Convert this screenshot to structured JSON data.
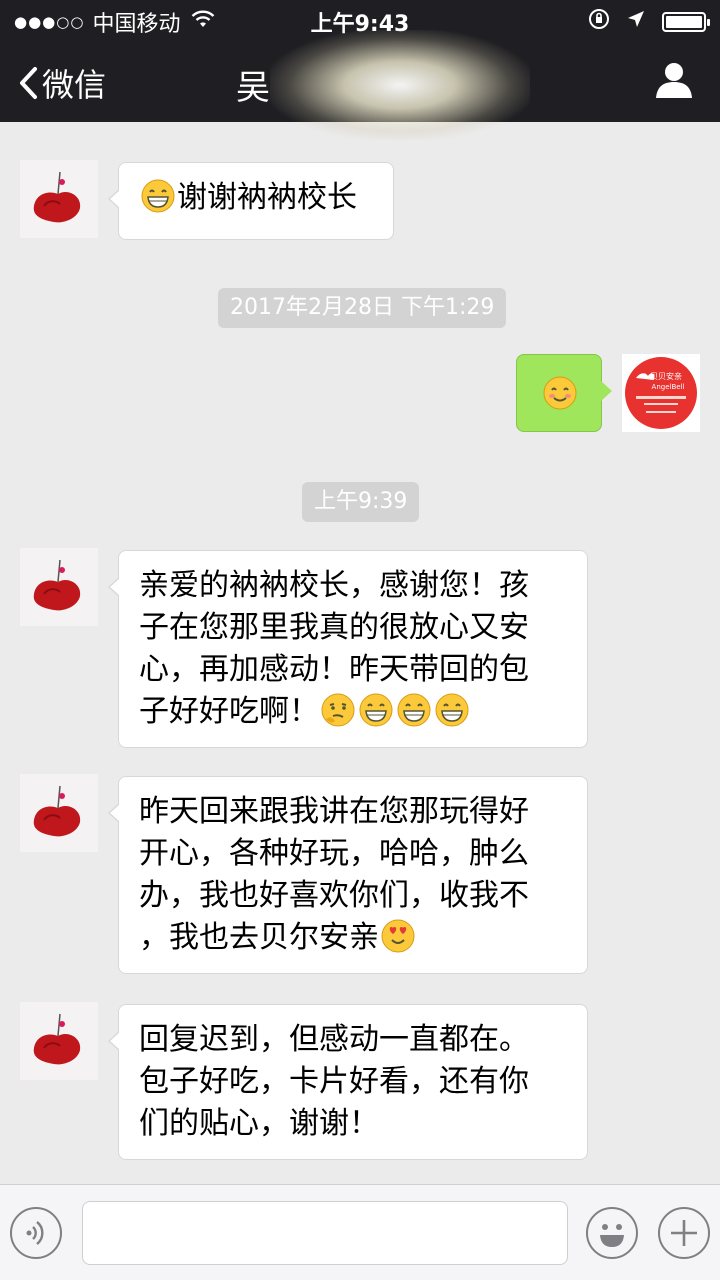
{
  "status_bar": {
    "signal": "●●●○○",
    "carrier": "中国移动",
    "time": "上午9:43"
  },
  "nav": {
    "back_label": "微信",
    "title": "吴"
  },
  "messages": [
    {
      "id": "m1",
      "direction": "incoming",
      "parts": [
        [
          "emoji:grin",
          "谢谢衲衲校长"
        ]
      ]
    },
    {
      "id": "t1",
      "type": "timestamp",
      "text": "2017年2月28日 下午1:29"
    },
    {
      "id": "m2",
      "direction": "outgoing",
      "parts": [
        [
          "emoji:smile"
        ]
      ]
    },
    {
      "id": "t2",
      "type": "timestamp",
      "text": "上午9:39"
    },
    {
      "id": "m3",
      "direction": "incoming",
      "lines": [
        "亲爱的衲衲校长，感谢您！孩",
        "子在您那里我真的很放心又安",
        "心，再加感动！昨天带回的包",
        "子好好吃啊！"
      ],
      "trailing_emojis": [
        "think",
        "grin",
        "grin",
        "grin"
      ]
    },
    {
      "id": "m4",
      "direction": "incoming",
      "lines": [
        "昨天回来跟我讲在您那玩得好",
        "开心，各种好玩，哈哈，肿么",
        "办，我也好喜欢你们，收我不",
        "，我也去贝尔安亲"
      ],
      "trailing_emojis": [
        "heart-eyes"
      ]
    },
    {
      "id": "m5",
      "direction": "incoming",
      "lines": [
        "回复迟到，但感动一直都在。",
        "包子好吃，卡片好看，还有你",
        "们的贴心，谢谢！"
      ]
    }
  ],
  "my_avatar": {
    "brand_cn": "贝贝安亲",
    "brand_en": "AngelBell"
  },
  "input_bar": {
    "placeholder": ""
  },
  "colors": {
    "topbar": "#1f1f23",
    "chat_bg": "#ebebeb",
    "outgoing_bubble": "#9fe65c",
    "logo_red": "#e8322f"
  }
}
